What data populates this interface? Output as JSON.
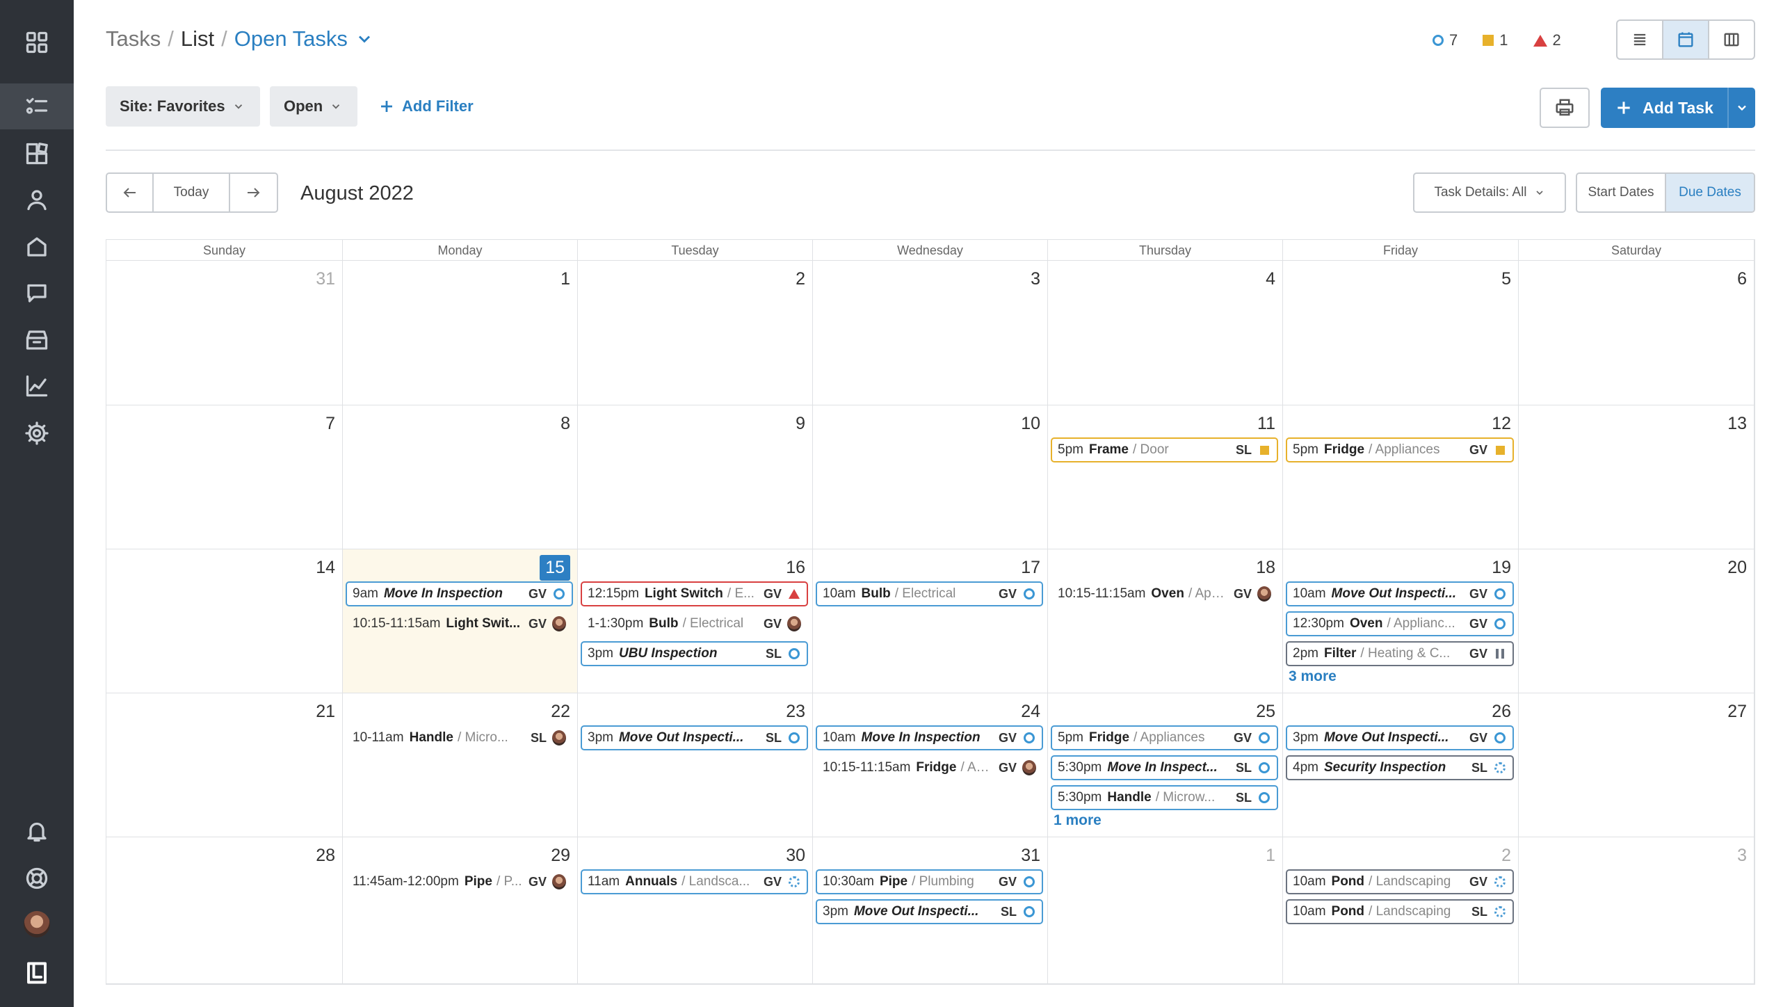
{
  "breadcrumb": {
    "tasks": "Tasks",
    "sep1": "/",
    "list": "List",
    "sep2": "/",
    "view": "Open Tasks"
  },
  "counters": [
    {
      "icon": "open-circle-icon",
      "value": "7"
    },
    {
      "icon": "yellow-square-icon",
      "value": "1"
    },
    {
      "icon": "red-triangle-icon",
      "value": "2"
    }
  ],
  "filters": {
    "site": "Site: Favorites",
    "status": "Open",
    "add_filter": "Add Filter"
  },
  "actions": {
    "add_task": "Add Task"
  },
  "calnav": {
    "today": "Today",
    "month": "August 2022"
  },
  "options": {
    "task_details": "Task Details: All",
    "start_dates": "Start Dates",
    "due_dates": "Due Dates"
  },
  "colors": {
    "accent": "#2d7fc3",
    "open": "#4a9bd4",
    "yellow": "#e7b12b",
    "red": "#d84040",
    "sidebar": "#2e3238"
  },
  "weekdays": [
    "Sunday",
    "Monday",
    "Tuesday",
    "Wednesday",
    "Thursday",
    "Friday",
    "Saturday"
  ],
  "weeks": [
    [
      {
        "day": "31",
        "other": true,
        "tasks": []
      },
      {
        "day": "1",
        "tasks": []
      },
      {
        "day": "2",
        "tasks": []
      },
      {
        "day": "3",
        "tasks": []
      },
      {
        "day": "4",
        "tasks": []
      },
      {
        "day": "5",
        "tasks": []
      },
      {
        "day": "6",
        "tasks": []
      }
    ],
    [
      {
        "day": "7",
        "tasks": []
      },
      {
        "day": "8",
        "tasks": []
      },
      {
        "day": "9",
        "tasks": []
      },
      {
        "day": "10",
        "tasks": []
      },
      {
        "day": "11",
        "tasks": [
          {
            "time": "5pm",
            "title": "Frame",
            "cat": "/ Door",
            "ini": "SL",
            "style": "yellow",
            "status": "square"
          }
        ]
      },
      {
        "day": "12",
        "tasks": [
          {
            "time": "5pm",
            "title": "Fridge",
            "cat": "/ Appliances",
            "ini": "GV",
            "style": "yellow",
            "status": "square"
          }
        ]
      },
      {
        "day": "13",
        "tasks": []
      }
    ],
    [
      {
        "day": "14",
        "tasks": []
      },
      {
        "day": "15",
        "today": true,
        "tasks": [
          {
            "time": "9am",
            "title": "Move In Inspection",
            "italic": true,
            "cat": "",
            "ini": "GV",
            "style": "blue",
            "status": "circle"
          },
          {
            "time": "10:15-11:15am",
            "title": "Light Swit...",
            "cat": "",
            "ini": "GV",
            "style": "plain",
            "status": "avatar"
          }
        ]
      },
      {
        "day": "16",
        "tasks": [
          {
            "time": "12:15pm",
            "title": "Light Switch",
            "cat": "/ E...",
            "ini": "GV",
            "style": "red",
            "status": "triangle"
          },
          {
            "time": "1-1:30pm",
            "title": "Bulb",
            "cat": "/ Electrical",
            "ini": "GV",
            "style": "plain",
            "status": "avatar"
          },
          {
            "time": "3pm",
            "title": "UBU Inspection",
            "italic": true,
            "cat": "",
            "ini": "SL",
            "style": "blue",
            "status": "circle"
          }
        ]
      },
      {
        "day": "17",
        "tasks": [
          {
            "time": "10am",
            "title": "Bulb",
            "cat": "/ Electrical",
            "ini": "GV",
            "style": "blue",
            "status": "circle"
          }
        ]
      },
      {
        "day": "18",
        "tasks": [
          {
            "time": "10:15-11:15am",
            "title": "Oven",
            "cat": "/ App...",
            "ini": "GV",
            "style": "plain",
            "status": "avatar"
          }
        ]
      },
      {
        "day": "19",
        "more": "3 more",
        "tasks": [
          {
            "time": "10am",
            "title": "Move Out Inspecti...",
            "italic": true,
            "cat": "",
            "ini": "GV",
            "style": "blue",
            "status": "circle"
          },
          {
            "time": "12:30pm",
            "title": "Oven",
            "cat": "/ Applianc...",
            "ini": "GV",
            "style": "blue",
            "status": "circle"
          },
          {
            "time": "2pm",
            "title": "Filter",
            "cat": "/ Heating & C...",
            "ini": "GV",
            "style": "dark",
            "status": "pause"
          }
        ]
      },
      {
        "day": "20",
        "tasks": []
      }
    ],
    [
      {
        "day": "21",
        "tasks": []
      },
      {
        "day": "22",
        "tasks": [
          {
            "time": "10-11am",
            "title": "Handle",
            "cat": "/ Micro...",
            "ini": "SL",
            "style": "plain",
            "status": "avatar"
          }
        ]
      },
      {
        "day": "23",
        "tasks": [
          {
            "time": "3pm",
            "title": "Move Out Inspecti...",
            "italic": true,
            "cat": "",
            "ini": "SL",
            "style": "blue",
            "status": "circle"
          }
        ]
      },
      {
        "day": "24",
        "tasks": [
          {
            "time": "10am",
            "title": "Move In Inspection",
            "italic": true,
            "cat": "",
            "ini": "GV",
            "style": "blue",
            "status": "circle"
          },
          {
            "time": "10:15-11:15am",
            "title": "Fridge",
            "cat": "/ Ap...",
            "ini": "GV",
            "style": "plain",
            "status": "avatar"
          }
        ]
      },
      {
        "day": "25",
        "more": "1 more",
        "tasks": [
          {
            "time": "5pm",
            "title": "Fridge",
            "cat": "/ Appliances",
            "ini": "GV",
            "style": "blue",
            "status": "circle"
          },
          {
            "time": "5:30pm",
            "title": "Move In Inspect...",
            "italic": true,
            "cat": "",
            "ini": "SL",
            "style": "blue",
            "status": "circle"
          },
          {
            "time": "5:30pm",
            "title": "Handle",
            "cat": "/ Microw...",
            "ini": "SL",
            "style": "blue",
            "status": "circle"
          }
        ]
      },
      {
        "day": "26",
        "tasks": [
          {
            "time": "3pm",
            "title": "Move Out Inspecti...",
            "italic": true,
            "cat": "",
            "ini": "GV",
            "style": "blue",
            "status": "circle"
          },
          {
            "time": "4pm",
            "title": "Security Inspection",
            "italic": true,
            "cat": "",
            "ini": "SL",
            "style": "dark",
            "status": "dashed"
          }
        ]
      },
      {
        "day": "27",
        "tasks": []
      }
    ],
    [
      {
        "day": "28",
        "tasks": []
      },
      {
        "day": "29",
        "tasks": [
          {
            "time": "11:45am-12:00pm",
            "title": "Pipe",
            "cat": "/ P...",
            "ini": "GV",
            "style": "plain",
            "status": "avatar"
          }
        ]
      },
      {
        "day": "30",
        "tasks": [
          {
            "time": "11am",
            "title": "Annuals",
            "cat": "/ Landsca...",
            "ini": "GV",
            "style": "blue",
            "status": "dashed"
          }
        ]
      },
      {
        "day": "31",
        "tasks": [
          {
            "time": "10:30am",
            "title": "Pipe",
            "cat": "/ Plumbing",
            "ini": "GV",
            "style": "blue",
            "status": "circle"
          },
          {
            "time": "3pm",
            "title": "Move Out Inspecti...",
            "italic": true,
            "cat": "",
            "ini": "SL",
            "style": "blue",
            "status": "circle"
          }
        ]
      },
      {
        "day": "1",
        "other": true,
        "tasks": []
      },
      {
        "day": "2",
        "other": true,
        "tasks": [
          {
            "time": "10am",
            "title": "Pond",
            "cat": "/ Landscaping",
            "ini": "GV",
            "style": "dark",
            "status": "dashed"
          },
          {
            "time": "10am",
            "title": "Pond",
            "cat": "/ Landscaping",
            "ini": "SL",
            "style": "dark",
            "status": "dashed"
          }
        ]
      },
      {
        "day": "3",
        "other": true,
        "tasks": []
      }
    ]
  ]
}
